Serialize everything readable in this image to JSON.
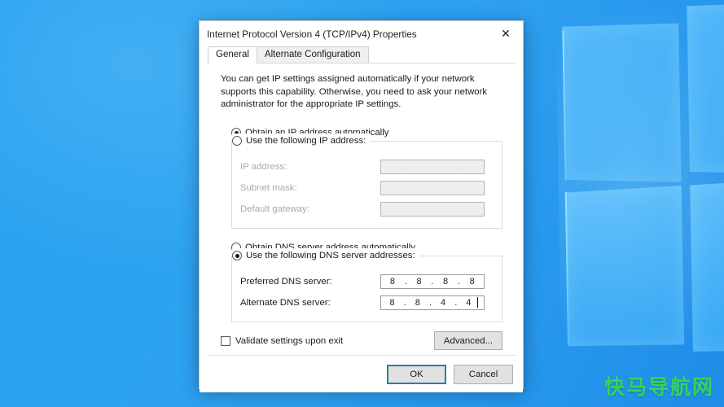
{
  "desktop": {
    "wallpaper_name": "windows-hero-wallpaper",
    "watermark": "快马导航网",
    "watermark_color": "#35d35a",
    "accent_color": "#2ba2f0"
  },
  "dialog": {
    "title": "Internet Protocol Version 4 (TCP/IPv4) Properties",
    "close_icon": "✕",
    "tabs": [
      {
        "label": "General",
        "active": true
      },
      {
        "label": "Alternate Configuration",
        "active": false
      }
    ],
    "description": "You can get IP settings assigned automatically if your network supports this capability. Otherwise, you need to ask your network administrator for the appropriate IP settings.",
    "ip_section": {
      "auto_option": {
        "label": "Obtain an IP address automatically",
        "selected": true
      },
      "manual_option": {
        "label": "Use the following IP address:",
        "selected": false
      },
      "fields": [
        {
          "label": "IP address:",
          "octets": [
            "",
            "",
            "",
            ""
          ],
          "disabled": true
        },
        {
          "label": "Subnet mask:",
          "octets": [
            "",
            "",
            "",
            ""
          ],
          "disabled": true
        },
        {
          "label": "Default gateway:",
          "octets": [
            "",
            "",
            "",
            ""
          ],
          "disabled": true
        }
      ]
    },
    "dns_section": {
      "auto_option": {
        "label": "Obtain DNS server address automatically",
        "selected": false
      },
      "manual_option": {
        "label": "Use the following DNS server addresses:",
        "selected": true
      },
      "fields": [
        {
          "label": "Preferred DNS server:",
          "octets": [
            "8",
            "8",
            "8",
            "8"
          ],
          "disabled": false,
          "focused": false
        },
        {
          "label": "Alternate DNS server:",
          "octets": [
            "8",
            "8",
            "4",
            "4"
          ],
          "disabled": false,
          "focused": true
        }
      ]
    },
    "validate_checkbox": {
      "label": "Validate settings upon exit",
      "checked": false
    },
    "advanced_button": "Advanced...",
    "ok_button": "OK",
    "cancel_button": "Cancel",
    "separator_dot": "."
  }
}
